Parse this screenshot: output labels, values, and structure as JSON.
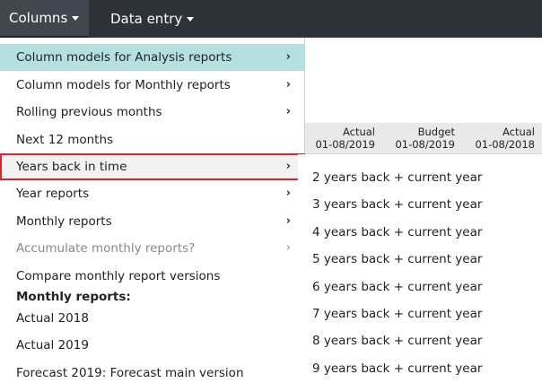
{
  "navbar": {
    "columns_label": "Columns",
    "data_entry_label": "Data entry"
  },
  "report_header": {
    "columns": [
      {
        "type": "Actual",
        "date": "01-08/2019"
      },
      {
        "type": "Budget",
        "date": "01-08/2019"
      },
      {
        "type": "Actual",
        "date": "01-08/2018"
      }
    ]
  },
  "menu": {
    "items": [
      {
        "label": "Column models for Analysis reports",
        "submenu": true
      },
      {
        "label": "Column models for Monthly reports",
        "submenu": true
      },
      {
        "label": "Rolling previous months",
        "submenu": true
      },
      {
        "label": "Next 12 months",
        "submenu": false
      },
      {
        "label": "Years back in time",
        "submenu": true
      },
      {
        "label": "Year reports",
        "submenu": true
      },
      {
        "label": "Monthly reports",
        "submenu": true
      },
      {
        "label": "Accumulate monthly reports?",
        "submenu": true
      },
      {
        "label": "Compare monthly report versions",
        "submenu": false
      }
    ],
    "section_label": "Monthly reports:",
    "section_items": [
      {
        "label": "Actual 2018"
      },
      {
        "label": "Actual 2019"
      },
      {
        "label": "Forecast 2019: Forecast main version"
      }
    ],
    "chevron": "›"
  },
  "submenu": {
    "items": [
      "2 years back + current year",
      "3 years back + current year",
      "4 years back + current year",
      "5 years back + current year",
      "6 years back + current year",
      "7 years back + current year",
      "8 years back + current year",
      "9 years back + current year"
    ]
  }
}
